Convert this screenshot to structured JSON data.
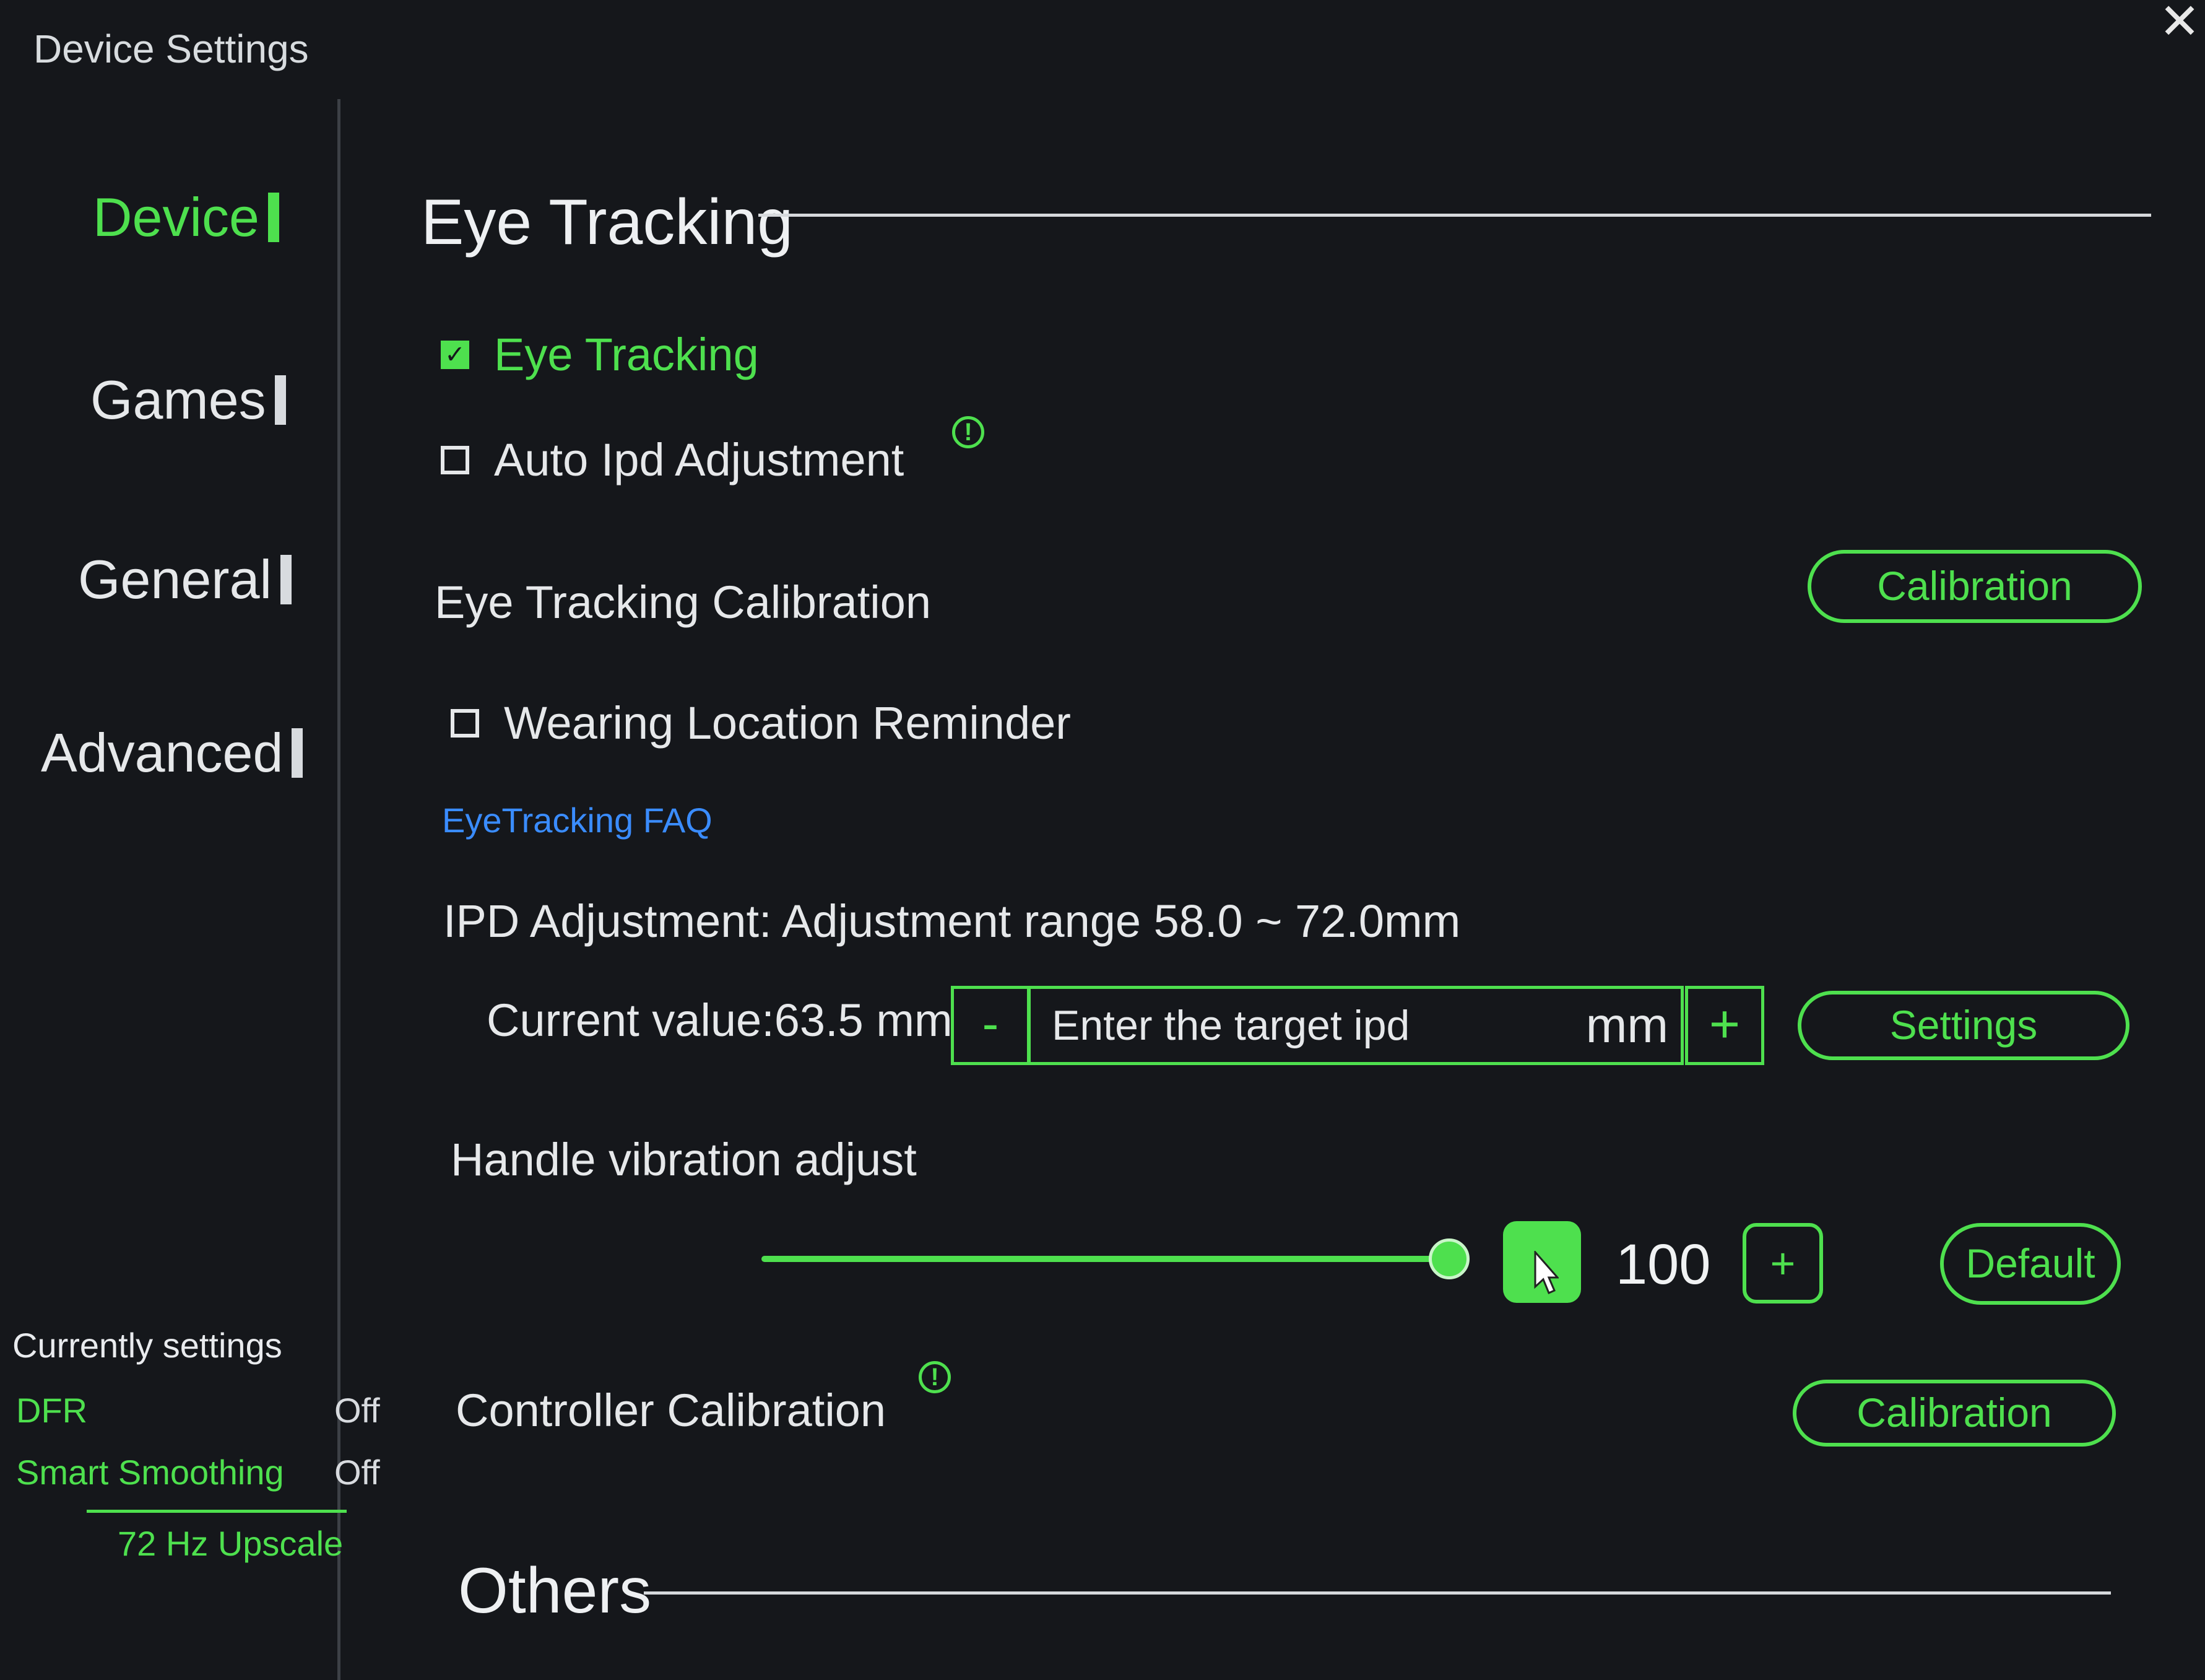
{
  "window": {
    "title": "Device Settings",
    "close_glyph": "✕"
  },
  "sidebar": {
    "items": [
      {
        "label": "Device",
        "active": true
      },
      {
        "label": "Games",
        "active": false
      },
      {
        "label": "General",
        "active": false
      },
      {
        "label": "Advanced",
        "active": false
      }
    ],
    "current": {
      "title": "Currently settings",
      "rows": [
        {
          "key": "DFR",
          "value": "Off"
        },
        {
          "key": "Smart Smoothing",
          "value": "Off"
        }
      ],
      "upscale": "72 Hz Upscale"
    }
  },
  "main": {
    "eye_tracking_section": "Eye Tracking",
    "eye_tracking_toggle": {
      "label": "Eye Tracking",
      "checked": true
    },
    "auto_ipd": {
      "label": "Auto Ipd Adjustment",
      "checked": false,
      "info_glyph": "!"
    },
    "calibration": {
      "label": "Eye Tracking Calibration",
      "button": "Calibration"
    },
    "wearing_reminder": {
      "label": "Wearing Location Reminder",
      "checked": false
    },
    "faq_link": "EyeTracking FAQ",
    "ipd": {
      "heading": "IPD Adjustment: Adjustment range 58.0 ~ 72.0mm",
      "current": "Current value:63.5 mm",
      "minus": "-",
      "placeholder": "Enter the target ipd",
      "unit": "mm",
      "plus": "+",
      "settings_button": "Settings"
    },
    "vibration": {
      "label": "Handle vibration adjust",
      "value": "100",
      "level": 1.0,
      "plus": "+",
      "default_button": "Default"
    },
    "controller_calibration": {
      "label": "Controller Calibration",
      "button": "Calibration",
      "info_glyph": "!"
    },
    "others_section": "Others"
  },
  "colors": {
    "accent": "#4ee04e",
    "background": "#15171b",
    "link": "#3a8cff",
    "text": "#e6e8ea"
  },
  "icons": [
    "close-icon",
    "checkmark-icon",
    "info-icon",
    "cursor-icon"
  ]
}
